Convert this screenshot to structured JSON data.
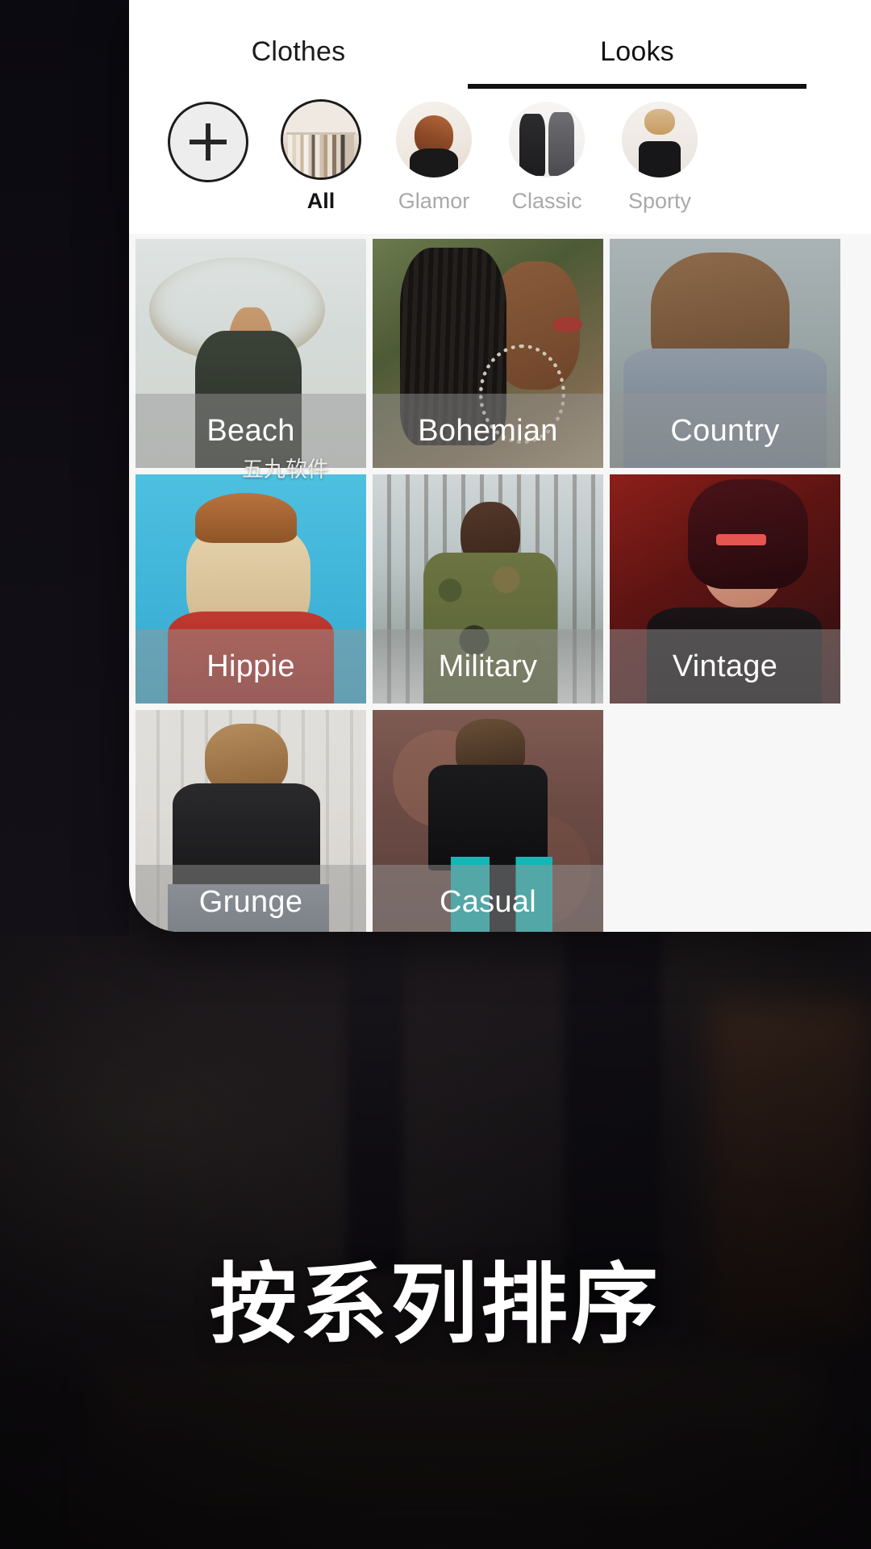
{
  "app": {
    "headline": "按系列排序",
    "watermark": "五九软件"
  },
  "tabs": [
    {
      "label": "Clothes",
      "active": false
    },
    {
      "label": "Looks",
      "active": true
    }
  ],
  "categories": [
    {
      "label": "",
      "icon": "plus-icon",
      "kind": "add",
      "selected": false
    },
    {
      "label": "All",
      "icon": "clothes-rack-thumb",
      "kind": "all",
      "selected": true
    },
    {
      "label": "Glamor",
      "icon": "glamor-thumb",
      "kind": "glamor",
      "selected": false
    },
    {
      "label": "Classic",
      "icon": "classic-thumb",
      "kind": "classic",
      "selected": false
    },
    {
      "label": "Sporty",
      "icon": "sporty-thumb",
      "kind": "sporty",
      "selected": false
    }
  ],
  "looks": [
    {
      "label": "Beach",
      "art": "beach"
    },
    {
      "label": "Bohemian",
      "art": "bohemian"
    },
    {
      "label": "Country",
      "art": "country"
    },
    {
      "label": "Hippie",
      "art": "hippie"
    },
    {
      "label": "Military",
      "art": "military"
    },
    {
      "label": "Vintage",
      "art": "vintage"
    },
    {
      "label": "Grunge",
      "art": "grunge"
    },
    {
      "label": "Casual",
      "art": "casual"
    }
  ],
  "colors": {
    "panel_bg": "#ffffff",
    "grid_bg": "#f7f7f7",
    "tab_active_underline": "#111111",
    "tab_inactive_text": "#1b1b1b",
    "category_label_inactive": "#a9a9a9",
    "category_label_active": "#141414",
    "caption_overlay": "rgba(150,150,150,0.48)",
    "caption_text": "#ffffff",
    "backdrop": "#0d0c12",
    "headline_text": "#ffffff"
  }
}
